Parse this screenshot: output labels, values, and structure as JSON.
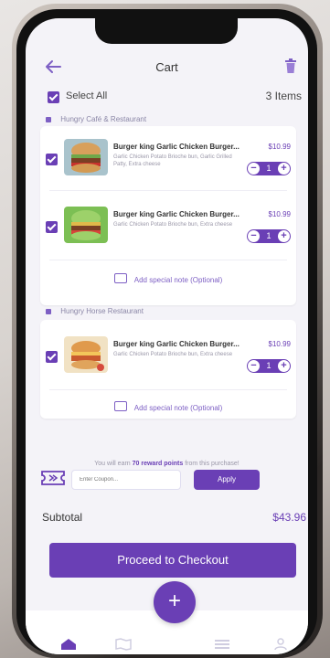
{
  "header": {
    "title": "Cart"
  },
  "selection": {
    "select_all_label": "Select All",
    "items_count": "3 Items"
  },
  "restaurants": [
    {
      "name": "Hungry Café & Restaurant",
      "items": [
        {
          "name": "Burger king Garlic Chicken Burger...",
          "price": "$10.99",
          "description": "Garlic Chicken Potato Brioche bun, Garlic Grilled Patty, Extra cheese",
          "quantity": "1"
        },
        {
          "name": "Burger king Garlic Chicken Burger...",
          "price": "$10.99",
          "description": "Garlic Chicken Potato Brioche bun, Extra cheese",
          "quantity": "1"
        }
      ],
      "note_label": "Add special note (Optional)"
    },
    {
      "name": "Hungry Horse Restaurant",
      "items": [
        {
          "name": "Burger king Garlic Chicken Burger...",
          "price": "$10.99",
          "description": "Garlic Chicken Potato Brioche bun, Extra cheese",
          "quantity": "1"
        }
      ],
      "note_label": "Add special note (Optional)"
    }
  ],
  "reward": {
    "prefix": "You will earn ",
    "points": "70 reward points",
    "suffix": " from this purchase!"
  },
  "coupon": {
    "placeholder": "Enter Coupon...",
    "apply_label": "Apply"
  },
  "summary": {
    "subtotal_label": "Subtotal",
    "subtotal_value": "$43.96"
  },
  "checkout": {
    "label": "Proceed to Checkout"
  },
  "fab": {
    "label": "+"
  },
  "icons": {
    "back": "arrow-left-icon",
    "delete": "trash-icon",
    "note": "note-icon",
    "coupon": "ticket-icon",
    "nav": [
      "home-icon",
      "map-icon",
      "list-icon",
      "profile-icon"
    ]
  },
  "colors": {
    "accent": "#6a3fb5",
    "background": "#f4f3f8"
  }
}
